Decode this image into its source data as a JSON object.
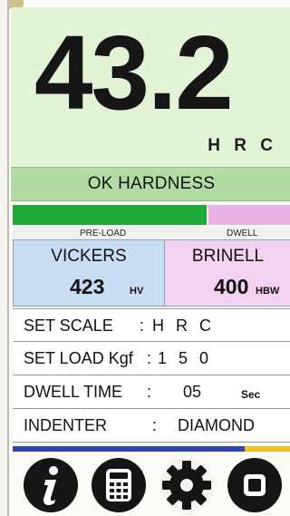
{
  "reading": {
    "value": "43.2",
    "unit": "H R C"
  },
  "status": {
    "text": "OK HARDNESS",
    "color": "#b3dca4"
  },
  "progress": {
    "preload_label": "PRE-LOAD",
    "dwell_label": "DWELL",
    "preload_color": "#22a838",
    "dwell_color": "#e9b4e4"
  },
  "conversions": {
    "vickers": {
      "name": "VICKERS",
      "value": "423",
      "unit": "HV"
    },
    "brinell": {
      "name": "BRINELL",
      "value": "400",
      "unit": "HBW"
    }
  },
  "settings": {
    "scale": {
      "label": "SET SCALE",
      "colon": ":",
      "value": "H R C"
    },
    "load": {
      "label": "SET LOAD Kgf",
      "colon": ":",
      "value": "1 5 0"
    },
    "dwell": {
      "label": "DWELL TIME",
      "colon": ":",
      "value": "05",
      "unit": "Sec"
    },
    "indenter": {
      "label": "INDENTER",
      "colon": ":",
      "value": "DIAMOND"
    }
  },
  "toolbar": {
    "icons": [
      "info-icon",
      "calculator-icon",
      "gear-icon",
      "stop-icon"
    ]
  }
}
